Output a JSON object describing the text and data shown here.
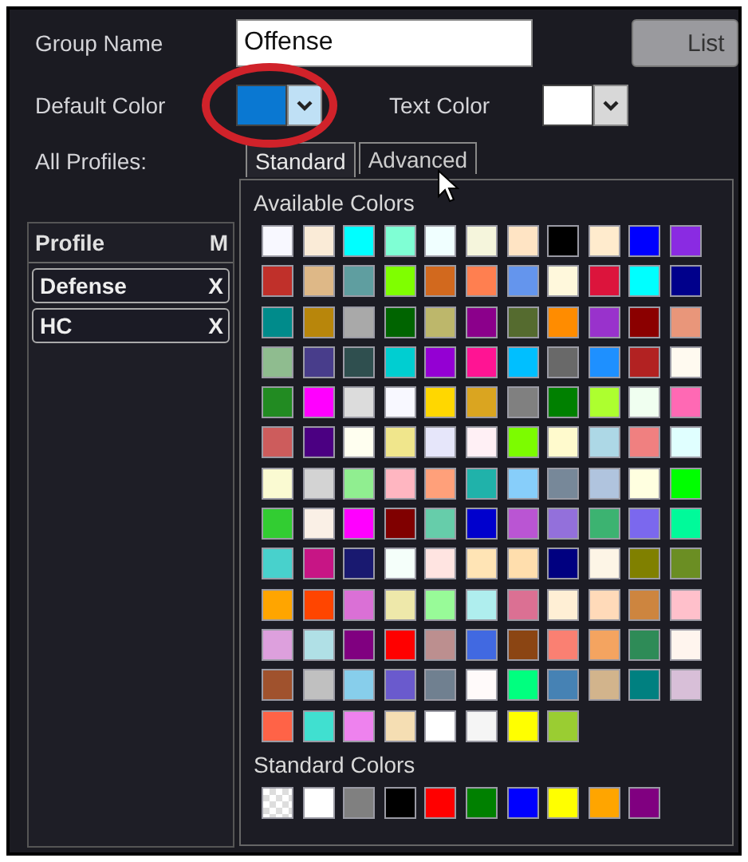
{
  "group_name": {
    "label": "Group Name",
    "value": "Offense"
  },
  "list_button": "List",
  "default_color": {
    "label": "Default Color",
    "color": "#0a78d2",
    "highlighted": true
  },
  "text_color": {
    "label": "Text Color",
    "color": "#ffffff"
  },
  "all_profiles_label": "All Profiles:",
  "profiles_table": {
    "columns": [
      "Profile",
      "M"
    ],
    "rows": [
      {
        "cells": [
          "Defense",
          "X"
        ]
      },
      {
        "cells": [
          "HC",
          "X"
        ]
      }
    ]
  },
  "color_tabs": [
    {
      "label": "Standard",
      "selected": true
    },
    {
      "label": "Advanced",
      "selected": false
    }
  ],
  "available_colors_title": "Available Colors",
  "available_colors": [
    {
      "color": "#f8f8ff"
    },
    {
      "color": "#faebd7"
    },
    {
      "color": "#00ffff"
    },
    {
      "color": "#7fffd4"
    },
    {
      "color": "#f0ffff"
    },
    {
      "color": "#f5f5dc"
    },
    {
      "color": "#ffe4c4"
    },
    {
      "color": "#000000"
    },
    {
      "color": "#ffebcd"
    },
    {
      "color": "#0000ff"
    },
    {
      "color": "#8a2be2"
    },
    {
      "color": "#c0302a"
    },
    {
      "color": "#deb887"
    },
    {
      "color": "#5f9ea0"
    },
    {
      "color": "#7fff00"
    },
    {
      "color": "#d2691e"
    },
    {
      "color": "#ff7f50"
    },
    {
      "color": "#6495ed"
    },
    {
      "color": "#fff8dc"
    },
    {
      "color": "#dc143c"
    },
    {
      "color": "#00ffff"
    },
    {
      "color": "#00008b"
    },
    {
      "color": "#008b8b"
    },
    {
      "color": "#b8860b"
    },
    {
      "color": "#a9a9a9"
    },
    {
      "color": "#006400"
    },
    {
      "color": "#bdb76b"
    },
    {
      "color": "#8b008b"
    },
    {
      "color": "#556b2f"
    },
    {
      "color": "#ff8c00"
    },
    {
      "color": "#9932cc"
    },
    {
      "color": "#8b0000"
    },
    {
      "color": "#e9967a"
    },
    {
      "color": "#8fbc8f"
    },
    {
      "color": "#483d8b"
    },
    {
      "color": "#2f4f4f"
    },
    {
      "color": "#00ced1"
    },
    {
      "color": "#9400d3"
    },
    {
      "color": "#ff1493"
    },
    {
      "color": "#00bfff"
    },
    {
      "color": "#696969"
    },
    {
      "color": "#1e90ff"
    },
    {
      "color": "#b22222"
    },
    {
      "color": "#fffaf0"
    },
    {
      "color": "#228b22"
    },
    {
      "color": "#ff00ff"
    },
    {
      "color": "#dcdcdc"
    },
    {
      "color": "#f8f8ff"
    },
    {
      "color": "#ffd700"
    },
    {
      "color": "#daa520"
    },
    {
      "color": "#808080"
    },
    {
      "color": "#008000"
    },
    {
      "color": "#adff2f"
    },
    {
      "color": "#f0fff0"
    },
    {
      "color": "#ff69b4"
    },
    {
      "color": "#cd5c5c"
    },
    {
      "color": "#4b0082"
    },
    {
      "color": "#fffff0"
    },
    {
      "color": "#f0e68c"
    },
    {
      "color": "#e6e6fa"
    },
    {
      "color": "#fff0f5"
    },
    {
      "color": "#7cfc00"
    },
    {
      "color": "#fffacd"
    },
    {
      "color": "#add8e6"
    },
    {
      "color": "#f08080"
    },
    {
      "color": "#e0ffff"
    },
    {
      "color": "#fafad2"
    },
    {
      "color": "#d3d3d3"
    },
    {
      "color": "#90ee90"
    },
    {
      "color": "#ffb6c1"
    },
    {
      "color": "#ffa07a"
    },
    {
      "color": "#20b2aa"
    },
    {
      "color": "#87cefa"
    },
    {
      "color": "#778899"
    },
    {
      "color": "#b0c4de"
    },
    {
      "color": "#ffffe0"
    },
    {
      "color": "#00ff00"
    },
    {
      "color": "#32cd32"
    },
    {
      "color": "#faf0e6"
    },
    {
      "color": "#ff00ff"
    },
    {
      "color": "#800000"
    },
    {
      "color": "#66cdaa"
    },
    {
      "color": "#0000cd"
    },
    {
      "color": "#ba55d3"
    },
    {
      "color": "#9370db"
    },
    {
      "color": "#3cb371"
    },
    {
      "color": "#7b68ee"
    },
    {
      "color": "#00fa9a"
    },
    {
      "color": "#48d1cc"
    },
    {
      "color": "#c71585"
    },
    {
      "color": "#191970"
    },
    {
      "color": "#f5fffa"
    },
    {
      "color": "#ffe4e1"
    },
    {
      "color": "#ffe4b5"
    },
    {
      "color": "#ffdead"
    },
    {
      "color": "#000080"
    },
    {
      "color": "#fdf5e6"
    },
    {
      "color": "#808000"
    },
    {
      "color": "#6b8e23"
    },
    {
      "color": "#ffa500"
    },
    {
      "color": "#ff4500"
    },
    {
      "color": "#da70d6"
    },
    {
      "color": "#eee8aa"
    },
    {
      "color": "#98fb98"
    },
    {
      "color": "#afeeee"
    },
    {
      "color": "#db7093"
    },
    {
      "color": "#ffefd5"
    },
    {
      "color": "#ffdab9"
    },
    {
      "color": "#cd853f"
    },
    {
      "color": "#ffc0cb"
    },
    {
      "color": "#dda0dd"
    },
    {
      "color": "#b0e0e6"
    },
    {
      "color": "#800080"
    },
    {
      "color": "#ff0000"
    },
    {
      "color": "#bc8f8f"
    },
    {
      "color": "#4169e1"
    },
    {
      "color": "#8b4513"
    },
    {
      "color": "#fa8072"
    },
    {
      "color": "#f4a460"
    },
    {
      "color": "#2e8b57"
    },
    {
      "color": "#fff5ee"
    },
    {
      "color": "#a0522d"
    },
    {
      "color": "#c0c0c0"
    },
    {
      "color": "#87ceeb"
    },
    {
      "color": "#6a5acd"
    },
    {
      "color": "#708090"
    },
    {
      "color": "#fffafa"
    },
    {
      "color": "#00ff7f"
    },
    {
      "color": "#4682b4"
    },
    {
      "color": "#d2b48c"
    },
    {
      "color": "#008080"
    },
    {
      "color": "#d8bfd8"
    },
    {
      "color": "#ff6347"
    },
    {
      "color": "#40e0d0"
    },
    {
      "color": "#ee82ee"
    },
    {
      "color": "#f5deb3"
    },
    {
      "color": "#ffffff"
    },
    {
      "color": "#f5f5f5"
    },
    {
      "color": "#ffff00"
    },
    {
      "color": "#9acd32"
    }
  ],
  "standard_colors_title": "Standard Colors",
  "standard_colors": [
    {
      "kind": "transparent"
    },
    {
      "kind": "solid",
      "color": "#ffffff"
    },
    {
      "kind": "solid",
      "color": "#808080"
    },
    {
      "kind": "solid",
      "color": "#000000"
    },
    {
      "kind": "solid",
      "color": "#ff0000"
    },
    {
      "kind": "solid",
      "color": "#008000"
    },
    {
      "kind": "solid",
      "color": "#0000ff"
    },
    {
      "kind": "solid",
      "color": "#ffff00"
    },
    {
      "kind": "solid",
      "color": "#ffa500"
    },
    {
      "kind": "solid",
      "color": "#800080"
    }
  ]
}
